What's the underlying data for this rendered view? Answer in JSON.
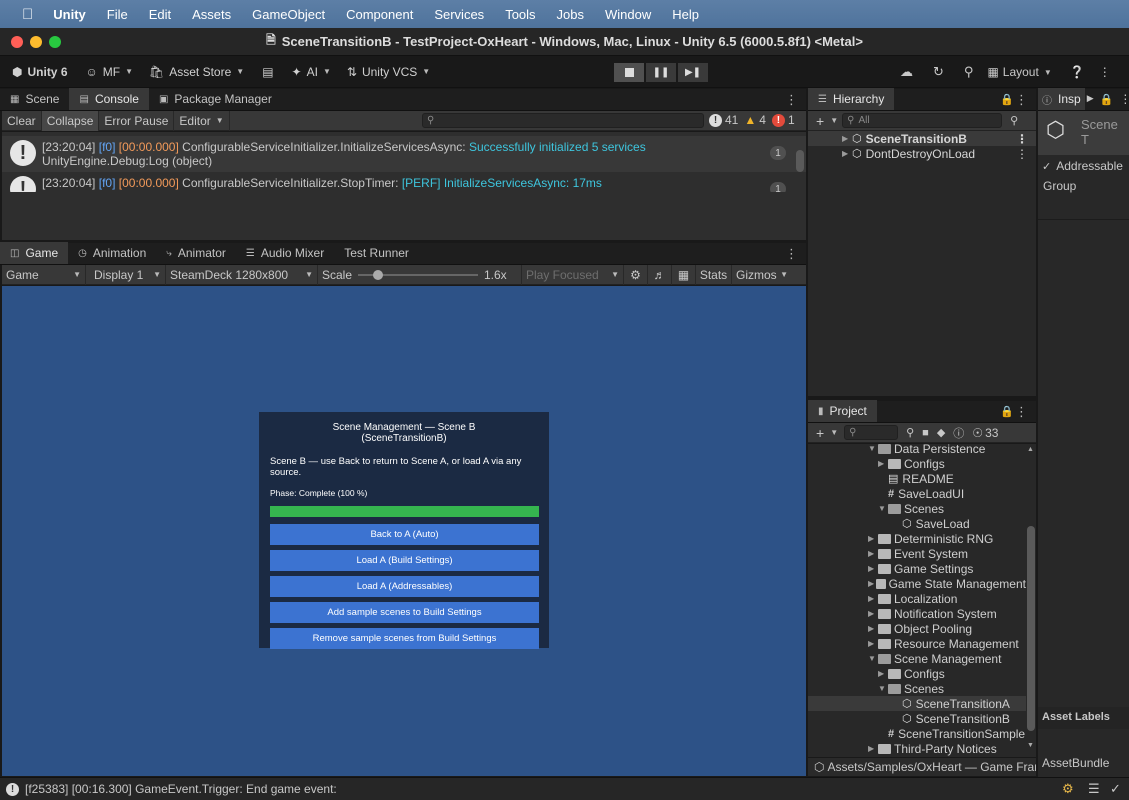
{
  "menubar": {
    "app": "Unity",
    "items": [
      "File",
      "Edit",
      "Assets",
      "GameObject",
      "Component",
      "Services",
      "Tools",
      "Jobs",
      "Window",
      "Help"
    ]
  },
  "window": {
    "title": "SceneTransitionB - TestProject-OxHeart - Windows, Mac, Linux - Unity 6.5 (6000.5.8f1) <Metal>"
  },
  "toolbar": {
    "unity_version": "Unity 6",
    "account": "MF",
    "asset_store": "Asset Store",
    "ai": "AI",
    "vcs": "Unity VCS",
    "layout": "Layout"
  },
  "top_tabs": [
    "Scene",
    "Console",
    "Package Manager"
  ],
  "console": {
    "clear": "Clear",
    "collapse": "Collapse",
    "error_pause": "Error Pause",
    "editor": "Editor",
    "search_placeholder": "",
    "count_log": "41",
    "count_warn": "4",
    "count_error": "1",
    "rows": [
      {
        "time": "[23:20:04]",
        "frame": "[f0]",
        "elapsed": "[00:00.000]",
        "msg": "ConfigurableServiceInitializer.InitializeServicesAsync:",
        "highlight": "Successfully initialized 5 services",
        "line2": "UnityEngine.Debug:Log (object)",
        "count": "1"
      },
      {
        "time": "[23:20:04]",
        "frame": "[f0]",
        "elapsed": "[00:00.000]",
        "msg": "ConfigurableServiceInitializer.StopTimer:",
        "highlight": "[PERF] InitializeServicesAsync: 17ms",
        "line2": "",
        "count": "1"
      }
    ]
  },
  "game_tabs": [
    "Game",
    "Animation",
    "Animator",
    "Audio Mixer",
    "Test Runner"
  ],
  "game_toolbar": {
    "mode": "Game",
    "display": "Display 1",
    "resolution": "SteamDeck 1280x800",
    "scale_label": "Scale",
    "scale_value": "1.6x",
    "scale_fraction": 0.17,
    "play_focused": "Play Focused",
    "stats": "Stats",
    "gizmos": "Gizmos"
  },
  "scene_panel": {
    "title": "Scene Management — Scene B (SceneTransitionB)",
    "description": "Scene B — use Back to return to Scene A, or load A via any source.",
    "phase": "Phase: Complete  (100 %)",
    "progress": 1.0,
    "buttons": [
      "Back to A (Auto)",
      "Load A (Build Settings)",
      "Load A (Addressables)",
      "Add sample scenes to Build Settings",
      "Remove sample scenes from Build Settings"
    ]
  },
  "hierarchy": {
    "tab": "Hierarchy",
    "search_placeholder": "All",
    "items": [
      "SceneTransitionB",
      "DontDestroyOnLoad"
    ]
  },
  "inspector": {
    "tab": "Insp",
    "object": "Scene T",
    "addressable": "Addressable",
    "group": "Group",
    "asset_labels": "Asset Labels",
    "asset_bundle": "AssetBundle"
  },
  "project": {
    "tab": "Project",
    "hidden_count": "33",
    "path": "Assets/Samples/OxHeart — Game Framework",
    "items": [
      {
        "label": "Data Persistence",
        "kind": "folder-open",
        "indent": 0
      },
      {
        "label": "Configs",
        "kind": "folder",
        "indent": 1
      },
      {
        "label": "README",
        "kind": "doc",
        "indent": 1
      },
      {
        "label": "SaveLoadUI",
        "kind": "script",
        "indent": 1
      },
      {
        "label": "Scenes",
        "kind": "folder-open",
        "indent": 1
      },
      {
        "label": "SaveLoad",
        "kind": "scene",
        "indent": 2
      },
      {
        "label": "Deterministic RNG",
        "kind": "folder",
        "indent": 0
      },
      {
        "label": "Event System",
        "kind": "folder",
        "indent": 0
      },
      {
        "label": "Game Settings",
        "kind": "folder",
        "indent": 0
      },
      {
        "label": "Game State Management",
        "kind": "folder",
        "indent": 0
      },
      {
        "label": "Localization",
        "kind": "folder",
        "indent": 0
      },
      {
        "label": "Notification System",
        "kind": "folder",
        "indent": 0
      },
      {
        "label": "Object Pooling",
        "kind": "folder",
        "indent": 0
      },
      {
        "label": "Resource Management",
        "kind": "folder",
        "indent": 0
      },
      {
        "label": "Scene Management",
        "kind": "folder-open",
        "indent": 0
      },
      {
        "label": "Configs",
        "kind": "folder",
        "indent": 1
      },
      {
        "label": "Scenes",
        "kind": "folder-open",
        "indent": 1
      },
      {
        "label": "SceneTransitionA",
        "kind": "scene",
        "indent": 2,
        "selected": true
      },
      {
        "label": "SceneTransitionB",
        "kind": "scene",
        "indent": 2
      },
      {
        "label": "SceneTransitionSample",
        "kind": "script",
        "indent": 1
      },
      {
        "label": "Third-Party Notices",
        "kind": "folder",
        "indent": 0
      }
    ]
  },
  "statusbar": {
    "text": "[f25383] [00:16.300] GameEvent.Trigger: End game event:"
  },
  "colors": {
    "game_bg": "#2d5287",
    "panel_bg": "#1b2a43",
    "button": "#3c73d1",
    "progress": "#35b54f",
    "teal_text": "#3ec6de"
  }
}
